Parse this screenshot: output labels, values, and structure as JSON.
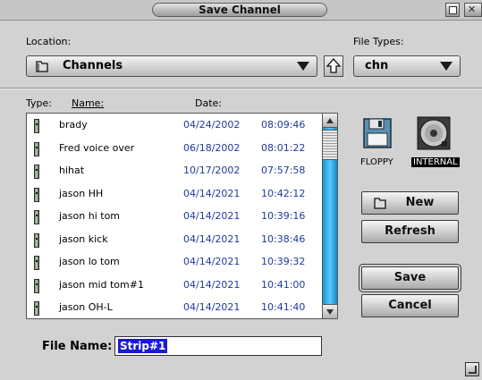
{
  "window": {
    "title": "Save Channel"
  },
  "location": {
    "label": "Location:",
    "value": "Channels"
  },
  "file_types": {
    "label": "File Types:",
    "value": "chn"
  },
  "columns": {
    "type": "Type:",
    "name": "Name:",
    "date": "Date:"
  },
  "files": [
    {
      "name": "brady",
      "date": "04/24/2002",
      "time": "08:09:46"
    },
    {
      "name": "Fred voice over",
      "date": "06/18/2002",
      "time": "08:01:22"
    },
    {
      "name": "hihat",
      "date": "10/17/2002",
      "time": "07:57:58"
    },
    {
      "name": "jason HH",
      "date": "04/14/2021",
      "time": "10:42:12"
    },
    {
      "name": "jason hi tom",
      "date": "04/14/2021",
      "time": "10:39:16"
    },
    {
      "name": "jason kick",
      "date": "04/14/2021",
      "time": "10:38:46"
    },
    {
      "name": "jason lo tom",
      "date": "04/14/2021",
      "time": "10:39:32"
    },
    {
      "name": "jason mid tom#1",
      "date": "04/14/2021",
      "time": "10:41:00"
    },
    {
      "name": "jason OH-L",
      "date": "04/14/2021",
      "time": "10:41:40"
    }
  ],
  "volumes": {
    "floppy": "FLOPPY",
    "internal": "INTERNAL"
  },
  "buttons": {
    "new": "New",
    "refresh": "Refresh",
    "save": "Save",
    "cancel": "Cancel"
  },
  "file_name": {
    "label": "File Name:",
    "value": "Strip#1"
  },
  "colors": {
    "list_date_text": "#1f3a9c",
    "scrollbar": "#2aa9ee",
    "selection": "#1b1bd4"
  }
}
